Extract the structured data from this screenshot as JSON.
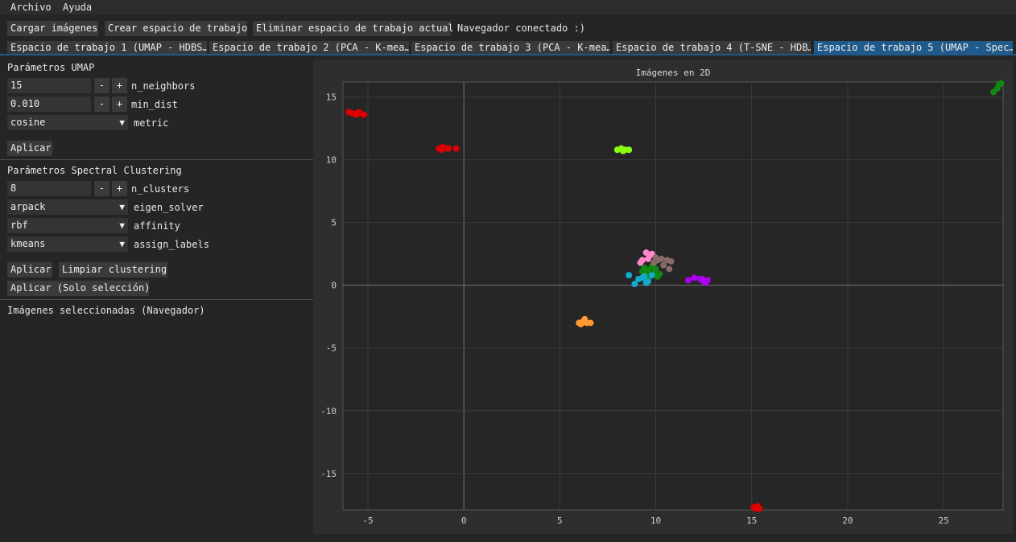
{
  "menu": {
    "file": "Archivo",
    "help": "Ayuda"
  },
  "toolbar": {
    "load_images": "Cargar imágenes",
    "create_workspace": "Crear espacio de trabajo",
    "delete_workspace": "Eliminar espacio de trabajo actual",
    "status": "Navegador conectado :)"
  },
  "tabs": [
    {
      "label": "Espacio de trabajo 1 (UMAP - HDBS…"
    },
    {
      "label": "Espacio de trabajo 2 (PCA - K-mea…"
    },
    {
      "label": "Espacio de trabajo 3 (PCA - K-mea…"
    },
    {
      "label": "Espacio de trabajo 4 (T-SNE - HDB…"
    },
    {
      "label": "Espacio de trabajo 5 (UMAP - Spec…"
    }
  ],
  "umap": {
    "header": "Parámetros UMAP",
    "n_neighbors_value": "15",
    "n_neighbors_label": "n_neighbors",
    "min_dist_value": "0.010",
    "min_dist_label": "min_dist",
    "metric_value": "cosine",
    "metric_label": "metric",
    "apply": "Aplicar"
  },
  "spectral": {
    "header": "Parámetros Spectral Clustering",
    "n_clusters_value": "8",
    "n_clusters_label": "n_clusters",
    "eigen_solver_value": "arpack",
    "eigen_solver_label": "eigen_solver",
    "affinity_value": "rbf",
    "affinity_label": "affinity",
    "assign_labels_value": "kmeans",
    "assign_labels_label": "assign_labels",
    "apply": "Aplicar",
    "clear": "Limpiar clustering",
    "apply_selection": "Aplicar (Solo selección)"
  },
  "selected_images_label": "Imágenes seleccionadas (Navegador)",
  "stepper": {
    "minus": "-",
    "plus": "+"
  },
  "dropdown_arrow": "▼",
  "chart_data": {
    "type": "scatter",
    "title": "Imágenes en 2D",
    "xlim": [
      -6.3,
      28.1
    ],
    "ylim": [
      -17.9,
      16.2
    ],
    "xticks": [
      -5,
      0,
      5,
      10,
      15,
      20,
      25
    ],
    "yticks": [
      -15,
      -10,
      -5,
      0,
      5,
      10,
      15
    ],
    "grid": true,
    "series": [
      {
        "color": "#dd0000",
        "points": [
          [
            -6.0,
            13.8
          ],
          [
            -5.8,
            13.7
          ],
          [
            -5.6,
            13.6
          ],
          [
            -5.4,
            13.7
          ],
          [
            -5.2,
            13.6
          ],
          [
            -5.5,
            13.8
          ],
          [
            -1.3,
            10.9
          ],
          [
            -1.1,
            11.0
          ],
          [
            -0.9,
            10.9
          ],
          [
            -1.2,
            10.8
          ],
          [
            -0.8,
            10.9
          ],
          [
            -0.4,
            10.9
          ],
          [
            15.1,
            -17.7
          ],
          [
            15.3,
            -17.6
          ],
          [
            15.4,
            -17.8
          ],
          [
            15.2,
            -17.8
          ]
        ]
      },
      {
        "color": "#118811",
        "points": [
          [
            27.6,
            15.4
          ],
          [
            27.8,
            15.7
          ],
          [
            27.9,
            16.0
          ],
          [
            28.0,
            16.1
          ],
          [
            9.3,
            1.1
          ],
          [
            9.6,
            1.2
          ],
          [
            9.9,
            1.0
          ],
          [
            10.2,
            0.9
          ],
          [
            9.8,
            1.5
          ],
          [
            9.5,
            0.9
          ],
          [
            10.0,
            1.3
          ],
          [
            9.7,
            0.7
          ],
          [
            10.1,
            0.7
          ],
          [
            9.4,
            1.4
          ]
        ]
      },
      {
        "color": "#88ff11",
        "points": [
          [
            8.0,
            10.8
          ],
          [
            8.2,
            10.9
          ],
          [
            8.4,
            10.8
          ],
          [
            8.6,
            10.8
          ],
          [
            8.3,
            10.7
          ]
        ]
      },
      {
        "color": "#ff9933",
        "points": [
          [
            6.0,
            -3.0
          ],
          [
            6.2,
            -2.9
          ],
          [
            6.4,
            -3.0
          ],
          [
            6.6,
            -3.0
          ],
          [
            6.3,
            -2.7
          ],
          [
            6.1,
            -3.1
          ]
        ]
      },
      {
        "color": "#aa00ee",
        "points": [
          [
            11.7,
            0.4
          ],
          [
            12.0,
            0.6
          ],
          [
            12.3,
            0.5
          ],
          [
            12.5,
            0.3
          ],
          [
            12.7,
            0.4
          ],
          [
            12.6,
            0.2
          ],
          [
            12.4,
            0.5
          ]
        ]
      },
      {
        "color": "#ff88cc",
        "points": [
          [
            9.3,
            2.0
          ],
          [
            9.5,
            2.6
          ],
          [
            9.7,
            2.4
          ],
          [
            9.2,
            1.8
          ],
          [
            9.6,
            2.1
          ],
          [
            9.8,
            2.5
          ]
        ]
      },
      {
        "color": "#8a6a6a",
        "points": [
          [
            10.0,
            2.2
          ],
          [
            10.3,
            2.1
          ],
          [
            10.6,
            2.0
          ],
          [
            10.8,
            1.9
          ],
          [
            10.4,
            1.6
          ],
          [
            10.1,
            2.0
          ],
          [
            10.7,
            1.3
          ],
          [
            9.9,
            1.8
          ]
        ]
      },
      {
        "color": "#11aacc",
        "points": [
          [
            8.6,
            0.8
          ],
          [
            8.9,
            0.1
          ],
          [
            9.1,
            0.5
          ],
          [
            9.3,
            0.6
          ],
          [
            9.6,
            0.3
          ],
          [
            9.4,
            0.7
          ],
          [
            9.8,
            0.8
          ],
          [
            9.5,
            0.2
          ]
        ]
      }
    ]
  }
}
